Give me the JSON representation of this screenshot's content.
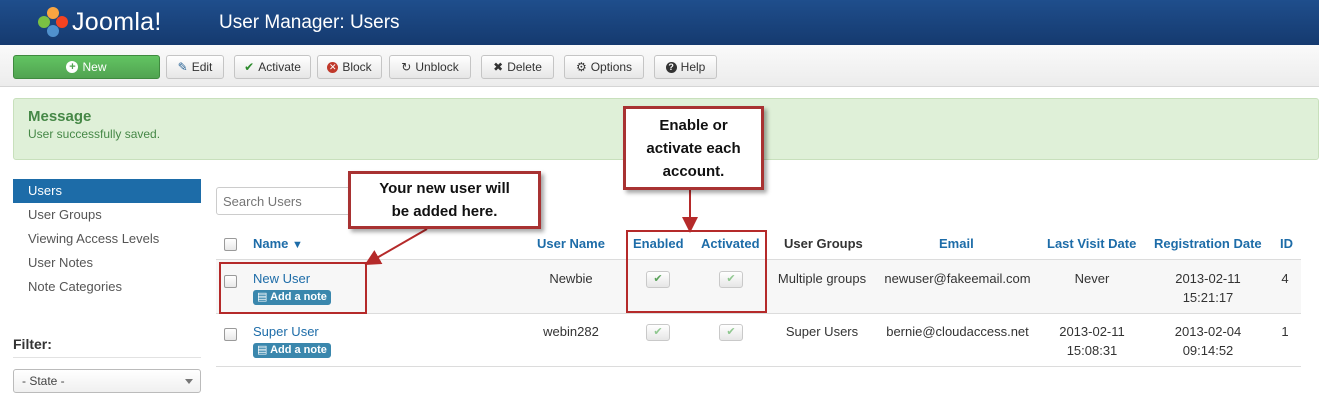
{
  "header": {
    "logo_text": "Joomla!",
    "title": "User Manager: Users"
  },
  "toolbar": {
    "new": "New",
    "edit": "Edit",
    "activate": "Activate",
    "block": "Block",
    "unblock": "Unblock",
    "delete": "Delete",
    "options": "Options",
    "help": "Help"
  },
  "message": {
    "heading": "Message",
    "text": "User successfully saved."
  },
  "sidebar": {
    "items": [
      {
        "label": "Users",
        "active": true
      },
      {
        "label": "User Groups"
      },
      {
        "label": "Viewing Access Levels"
      },
      {
        "label": "User Notes"
      },
      {
        "label": "Note Categories"
      }
    ],
    "filter_label": "Filter:",
    "state_select": "- State -"
  },
  "search": {
    "placeholder": "Search Users"
  },
  "table": {
    "columns": {
      "name": "Name",
      "username": "User Name",
      "enabled": "Enabled",
      "activated": "Activated",
      "groups": "User Groups",
      "email": "Email",
      "last_visit": "Last Visit Date",
      "registration": "Registration Date",
      "id": "ID"
    },
    "note_label": "Add a note",
    "rows": [
      {
        "name": "New User",
        "username": "Newbie",
        "groups": "Multiple groups",
        "email": "newuser@fakeemail.com",
        "last_visit": "Never",
        "last_visit_time": "",
        "reg_date": "2013-02-11",
        "reg_time": "15:21:17",
        "id": "4"
      },
      {
        "name": "Super User",
        "username": "webin282",
        "groups": "Super Users",
        "email": "bernie@cloudaccess.net",
        "last_visit": "2013-02-11",
        "last_visit_time": "15:08:31",
        "reg_date": "2013-02-04",
        "reg_time": "09:14:52",
        "id": "1"
      }
    ]
  },
  "annotations": {
    "new_user_callout": [
      "Your new user will",
      "be added here."
    ],
    "enable_callout": [
      "Enable or",
      "activate each",
      "account."
    ]
  },
  "colors": {
    "header_bg": "#1f4e8c",
    "accent_blue": "#1d6ca8",
    "new_button": "#51a351",
    "message_bg": "#dff0d8",
    "annotation_red": "#a83232"
  }
}
